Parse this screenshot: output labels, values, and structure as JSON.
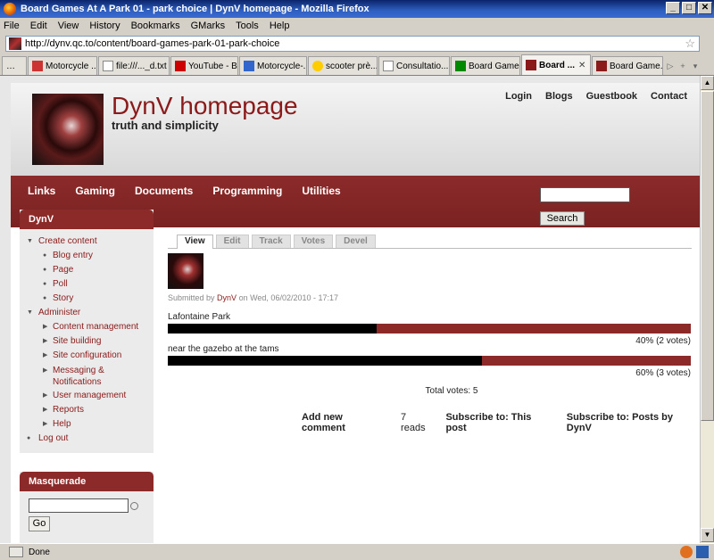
{
  "window": {
    "title": "Board Games At A Park 01 - park choice | DynV homepage - Mozilla Firefox",
    "buttons": [
      "_",
      "□",
      "✕"
    ]
  },
  "menubar": [
    "File",
    "Edit",
    "View",
    "History",
    "Bookmarks",
    "GMarks",
    "Tools",
    "Help"
  ],
  "address": {
    "url": "http://dynv.qc.to/content/board-games-park-01-park-choice"
  },
  "tabs": [
    {
      "label": "…",
      "color": "#d4d0c8"
    },
    {
      "label": "Motorcycle ...",
      "color": "#cc3333"
    },
    {
      "label": "file:///..._d.txt",
      "color": "#ffffff"
    },
    {
      "label": "YouTube - B...",
      "color": "#cc0000"
    },
    {
      "label": "Motorcycle-...",
      "color": "#3366cc"
    },
    {
      "label": "scooter prè...",
      "color": "#ffcc00"
    },
    {
      "label": "Consultatio...",
      "color": "#ffffff"
    },
    {
      "label": "Board Game...",
      "color": "#008800"
    },
    {
      "label": "Board ...",
      "color": "#8b1a1a",
      "active": true
    },
    {
      "label": "Board Game...",
      "color": "#8b1a1a"
    }
  ],
  "site": {
    "name": "DynV homepage",
    "slogan": "truth and simplicity",
    "toplinks": [
      "Login",
      "Blogs",
      "Guestbook",
      "Contact"
    ],
    "nav": [
      "Links",
      "Gaming",
      "Documents",
      "Programming",
      "Utilities"
    ],
    "search_button": "Search",
    "accent": "#8c2a2a"
  },
  "sidebar": {
    "block_title": "DynV",
    "items": [
      {
        "label": "Create content",
        "level": 1,
        "marker": "▼"
      },
      {
        "label": "Blog entry",
        "level": 2,
        "marker": "●"
      },
      {
        "label": "Page",
        "level": 2,
        "marker": "●"
      },
      {
        "label": "Poll",
        "level": 2,
        "marker": "●"
      },
      {
        "label": "Story",
        "level": 2,
        "marker": "●"
      },
      {
        "label": "Administer",
        "level": 1,
        "marker": "▼"
      },
      {
        "label": "Content management",
        "level": 2,
        "marker": "▶"
      },
      {
        "label": "Site building",
        "level": 2,
        "marker": "▶"
      },
      {
        "label": "Site configuration",
        "level": 2,
        "marker": "▶"
      },
      {
        "label": "Messaging & Notifications",
        "level": 2,
        "marker": "▶",
        "tall": true
      },
      {
        "label": "User management",
        "level": 2,
        "marker": "▶"
      },
      {
        "label": "Reports",
        "level": 2,
        "marker": "▶"
      },
      {
        "label": "Help",
        "level": 2,
        "marker": "▶"
      },
      {
        "label": "Log out",
        "level": 1,
        "marker": "●"
      }
    ],
    "masquerade_title": "Masquerade",
    "masquerade_button": "Go"
  },
  "content": {
    "tabs": [
      "View",
      "Edit",
      "Track",
      "Votes",
      "Devel"
    ],
    "submitted_prefix": "Submitted by",
    "author": "DynV",
    "submitted_suffix": "on Wed, 06/02/2010 - 17:17",
    "poll": [
      {
        "choice": "Lafontaine Park",
        "fraction": 0.4,
        "result": "40% (2 votes)"
      },
      {
        "choice": "near the gazebo at the tams",
        "fraction": 0.6,
        "result": "60% (3 votes)"
      }
    ],
    "total_votes": "Total votes: 5",
    "links": [
      "Add new comment",
      "7 reads",
      "Subscribe to: This post",
      "Subscribe to: Posts by DynV"
    ]
  },
  "statusbar": {
    "text": "Done"
  }
}
